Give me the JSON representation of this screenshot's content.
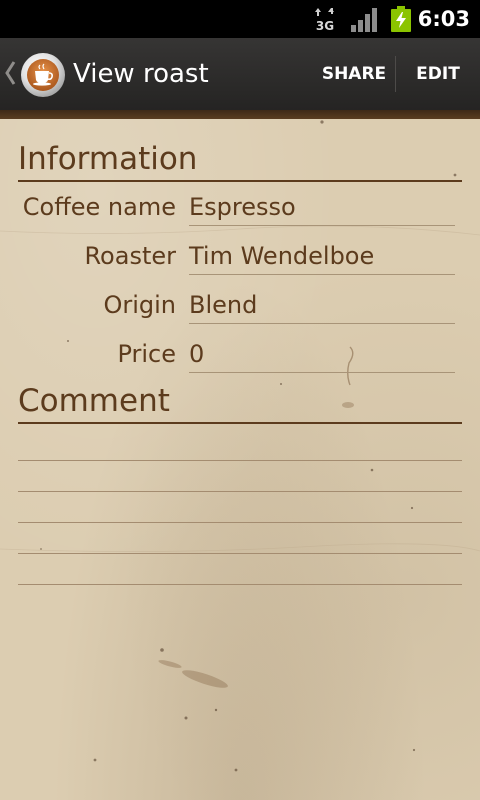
{
  "status_bar": {
    "network_type": "3G",
    "time": "6:03",
    "icons": [
      "network-3g-icon",
      "signal-strength-icon",
      "battery-charging-icon"
    ],
    "battery_color": "#8bc400"
  },
  "action_bar": {
    "title": "View roast",
    "app_icon": "coffee-cup-icon",
    "share_label": "SHARE",
    "edit_label": "EDIT"
  },
  "information": {
    "header": "Information",
    "fields": [
      {
        "label": "Coffee name",
        "value": "Espresso"
      },
      {
        "label": "Roaster",
        "value": "Tim Wendelboe"
      },
      {
        "label": "Origin",
        "value": "Blend"
      },
      {
        "label": "Price",
        "value": "0"
      }
    ]
  },
  "comment": {
    "header": "Comment",
    "text": ""
  },
  "colors": {
    "ink": "#5c3b1d",
    "paper": "#dccdb1",
    "action_bar": "#2c2b2a"
  }
}
